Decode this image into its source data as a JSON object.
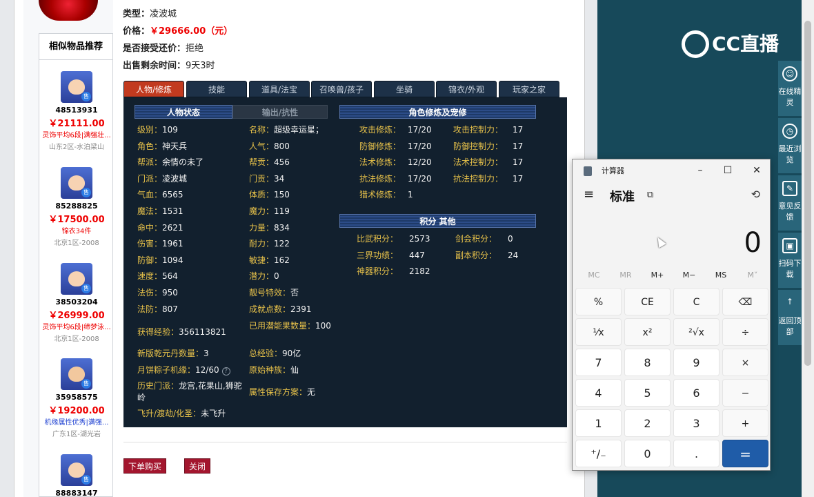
{
  "item": {
    "type_label": "类型：",
    "type_value": "凌波城",
    "price_label": "价格：",
    "price_value": "￥29666.00（元）",
    "bargain_label": "是否接受还价：",
    "bargain_value": "拒绝",
    "remaining_label": "出售剩余时间：",
    "remaining_value": "9天3时"
  },
  "side": {
    "title": "相似物品推荐",
    "items": [
      {
        "id": "48513931",
        "price": "￥21111.00",
        "desc": "灵饰平均6段|满强壮...",
        "desc_color": "red",
        "server": "山东2区-水泊梁山"
      },
      {
        "id": "85288825",
        "price": "￥17500.00",
        "desc": "锦衣34件",
        "desc_color": "red",
        "server": "北京1区-2008"
      },
      {
        "id": "38503204",
        "price": "￥26999.00",
        "desc": "灵饰平均6段|缔梦泳...",
        "desc_color": "red",
        "server": "北京1区-2008"
      },
      {
        "id": "35958575",
        "price": "￥19200.00",
        "desc": "机缘属性优秀|满强...",
        "desc_color": "blue",
        "server": "广东1区-湖光岩"
      },
      {
        "id": "88883147",
        "price": "",
        "desc": "",
        "desc_color": "red",
        "server": ""
      }
    ],
    "tag": "售"
  },
  "tabs": [
    "人物/修炼",
    "技能",
    "道具/法宝",
    "召唤兽/孩子",
    "坐骑",
    "锦衣/外观",
    "玩家之家"
  ],
  "sections": {
    "status": "人物状态",
    "output": "输出/抗性",
    "cultivation": "角色修炼及宠修",
    "points": "积分 其他"
  },
  "stats_left": [
    {
      "k": "级别：",
      "v": "109"
    },
    {
      "k": "角色：",
      "v": "神天兵"
    },
    {
      "k": "帮派：",
      "v": "余情の未了"
    },
    {
      "k": "门派：",
      "v": "凌波城"
    },
    {
      "k": "气血：",
      "v": "6565"
    },
    {
      "k": "魔法：",
      "v": "1531"
    },
    {
      "k": "命中：",
      "v": "2621"
    },
    {
      "k": "伤害：",
      "v": "1961"
    },
    {
      "k": "防御：",
      "v": "1094"
    },
    {
      "k": "速度：",
      "v": "564"
    },
    {
      "k": "法伤：",
      "v": "950"
    },
    {
      "k": "法防：",
      "v": "807"
    }
  ],
  "stats_mid": [
    {
      "k": "名称：",
      "v": "超级幸运星；"
    },
    {
      "k": "人气：",
      "v": "800"
    },
    {
      "k": "帮贡：",
      "v": "456"
    },
    {
      "k": "门贡：",
      "v": "34"
    },
    {
      "k": "体质：",
      "v": "150"
    },
    {
      "k": "魔力：",
      "v": "119"
    },
    {
      "k": "力量：",
      "v": "834"
    },
    {
      "k": "耐力：",
      "v": "122"
    },
    {
      "k": "敏捷：",
      "v": "162"
    },
    {
      "k": "潜力：",
      "v": "0"
    },
    {
      "k": "靓号特效：",
      "v": "否"
    },
    {
      "k": "成就点数：",
      "v": "2391"
    }
  ],
  "extra": {
    "exp_k": "获得经验：",
    "exp_v": "356113821",
    "potion_k": "已用潜能果数量：",
    "potion_v": "100",
    "qiankun_k": "新版乾元丹数量：",
    "qiankun_v": "3",
    "total_k": "总经验：",
    "total_v": "90亿",
    "zongzi_k": "月饼粽子机缘：",
    "zongzi_v": "12/60",
    "race_k": "原始种族：",
    "race_v": "仙",
    "history_k": "历史门派：",
    "history_v": "龙宫,花果山,狮驼岭",
    "attrsave_k": "属性保存方案：",
    "attrsave_v": "无",
    "fly_k": "飞升/渡劫/化圣：",
    "fly_v": "未飞升"
  },
  "cult_left": [
    {
      "k": "攻击修炼：",
      "v": "17/20"
    },
    {
      "k": "防御修炼：",
      "v": "17/20"
    },
    {
      "k": "法术修炼：",
      "v": "12/20"
    },
    {
      "k": "抗法修炼：",
      "v": "17/20"
    },
    {
      "k": "猎术修炼：",
      "v": "1"
    }
  ],
  "cult_right": [
    {
      "k": "攻击控制力：",
      "v": "17"
    },
    {
      "k": "防御控制力：",
      "v": "17"
    },
    {
      "k": "法术控制力：",
      "v": "17"
    },
    {
      "k": "抗法控制力：",
      "v": "17"
    }
  ],
  "points": [
    {
      "k": "比武积分：",
      "v": "2573"
    },
    {
      "k": "三界功绩：",
      "v": "447"
    },
    {
      "k": "神器积分：",
      "v": "2182"
    }
  ],
  "points_right": [
    {
      "k": "剑会积分：",
      "v": "0"
    },
    {
      "k": "副本积分：",
      "v": "24"
    }
  ],
  "buttons": {
    "buy": "下单购买",
    "close": "关闭"
  },
  "brand": {
    "logo_text": "CC直播"
  },
  "toolbar": [
    {
      "label": "在线精灵",
      "icon": "spirit-icon"
    },
    {
      "label": "最近浏览",
      "icon": "clock-icon"
    },
    {
      "label": "意见反馈",
      "icon": "edit-icon"
    },
    {
      "label": "扫码下载",
      "icon": "scan-icon"
    },
    {
      "label": "返回顶部",
      "icon": "arrow-up-icon"
    }
  ],
  "calculator": {
    "title": "计算器",
    "mode": "标准",
    "display": "0",
    "memory": [
      "MC",
      "MR",
      "M+",
      "M−",
      "MS",
      "M˅"
    ],
    "keys": [
      "%",
      "CE",
      "C",
      "⌫",
      "¹⁄x",
      "x²",
      "²√x",
      "÷",
      "7",
      "8",
      "9",
      "×",
      "4",
      "5",
      "6",
      "−",
      "1",
      "2",
      "3",
      "+",
      "⁺/₋",
      "0",
      ".",
      "="
    ]
  },
  "colors": {
    "accent_red": "#e00000",
    "tab_active": "#c23a1f",
    "panel_bg": "#12202e",
    "label_gold": "#e8c24a",
    "calc_equals": "#1f5ca8"
  }
}
